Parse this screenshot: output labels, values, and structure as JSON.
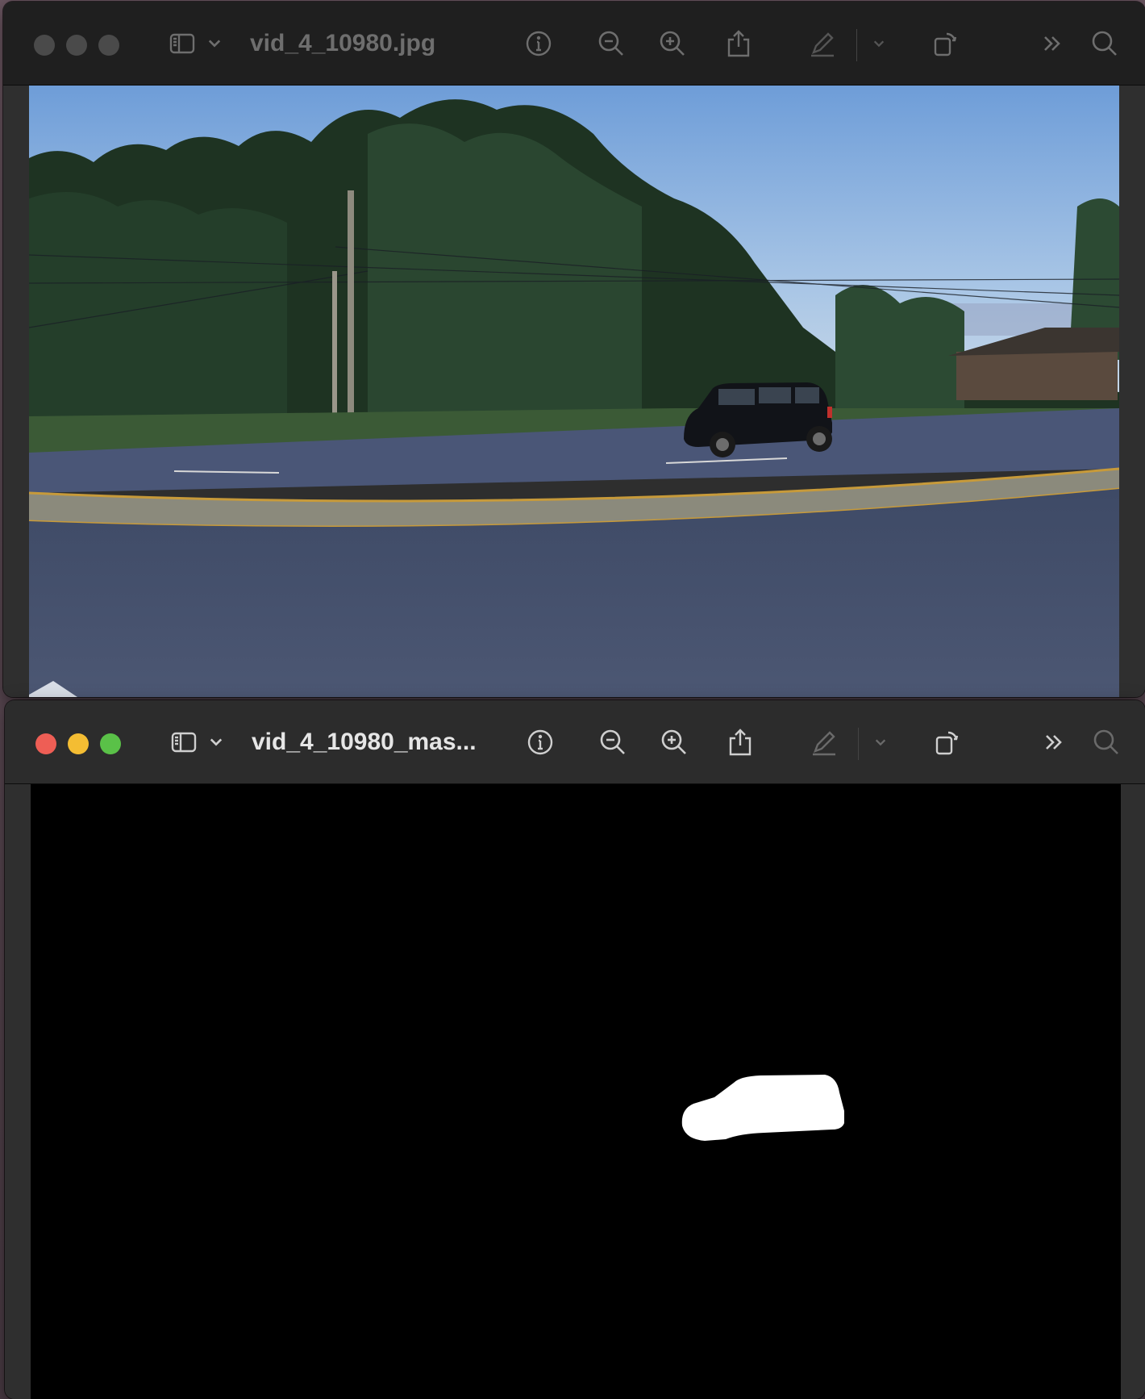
{
  "window_photo": {
    "title": "vid_4_10980.jpg",
    "active": false
  },
  "window_mask": {
    "title": "vid_4_10980_mas...",
    "active": true
  },
  "toolbar": {
    "icons": [
      "sidebar-icon",
      "chevron-down-icon",
      "info-icon",
      "zoom-out-icon",
      "zoom-in-icon",
      "share-icon",
      "markup-pen-icon",
      "chevron-down-icon",
      "rotate-icon",
      "more-chevrons-icon",
      "search-icon"
    ]
  },
  "colors": {
    "close": "#ee5e55",
    "minimize": "#f4bd33",
    "maximize": "#5ac148",
    "mask_background": "#000000",
    "mask_foreground": "#ffffff"
  }
}
